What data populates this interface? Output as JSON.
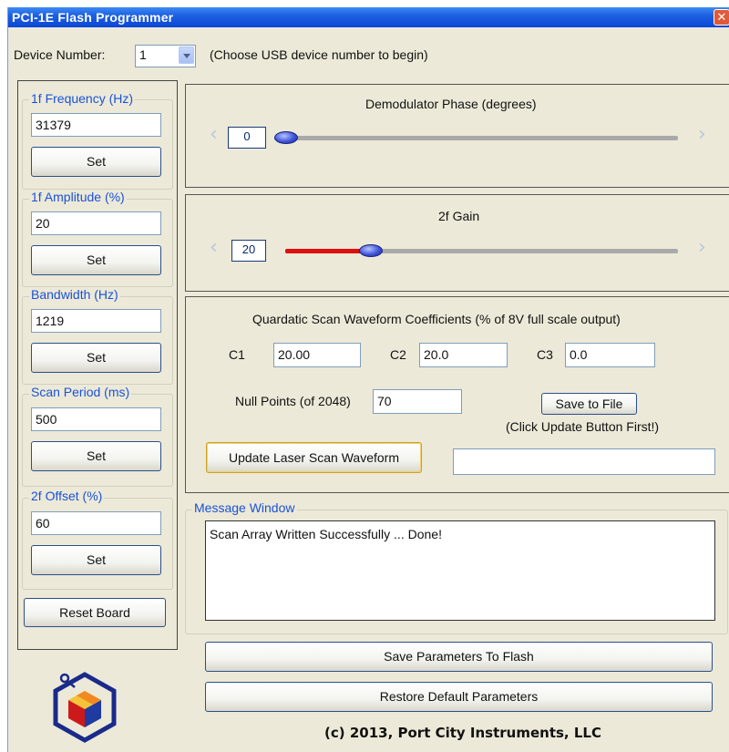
{
  "window": {
    "title": "PCI-1E Flash Programmer",
    "close_glyph": "✕"
  },
  "device": {
    "label": "Device Number:",
    "value": "1",
    "hint": "(Choose USB device number to begin)"
  },
  "params": [
    {
      "legend": "1f Frequency (Hz)",
      "value": "31379",
      "button": "Set"
    },
    {
      "legend": "1f Amplitude (%)",
      "value": "20",
      "button": "Set"
    },
    {
      "legend": "Bandwidth (Hz)",
      "value": "1219",
      "button": "Set"
    },
    {
      "legend": "Scan Period (ms)",
      "value": "500",
      "button": "Set"
    },
    {
      "legend": "2f Offset  (%)",
      "value": "60",
      "button": "Set"
    }
  ],
  "reset_button": "Reset Board",
  "demod": {
    "title": "Demodulator Phase (degrees)",
    "value": "0",
    "fraction": 0.0
  },
  "gain": {
    "title": "2f Gain",
    "value": "20",
    "fraction": 0.2
  },
  "chevrons": {
    "left": "‹",
    "right": "›"
  },
  "scan": {
    "title": "Quardatic Scan Waveform Coefficients (% of 8V full scale output)",
    "c1_label": "C1",
    "c1_value": "20.00",
    "c2_label": "C2",
    "c2_value": "20.0",
    "c3_label": "C3",
    "c3_value": "0.0",
    "null_label": "Null Points (of 2048)",
    "null_value": "70",
    "save_file_button": "Save to File",
    "save_file_hint": "(Click Update Button First!)",
    "update_button": "Update Laser Scan Waveform",
    "status_value": ""
  },
  "message": {
    "legend": "Message Window",
    "text": "Scan Array Written Successfully ... Done!"
  },
  "save_flash_button": "Save Parameters To Flash",
  "restore_button": "Restore  Default Parameters",
  "copyright": "(c) 2013, Port City Instruments, LLC",
  "colors": {
    "title_bar": "#0a46d6",
    "legend_text": "#1a52d9",
    "gain_fill": "#dd1010",
    "knob": "#3f55d8",
    "logo_orange": "#f0a020",
    "logo_red": "#cc1a1a",
    "logo_blue": "#1a2a8a"
  }
}
